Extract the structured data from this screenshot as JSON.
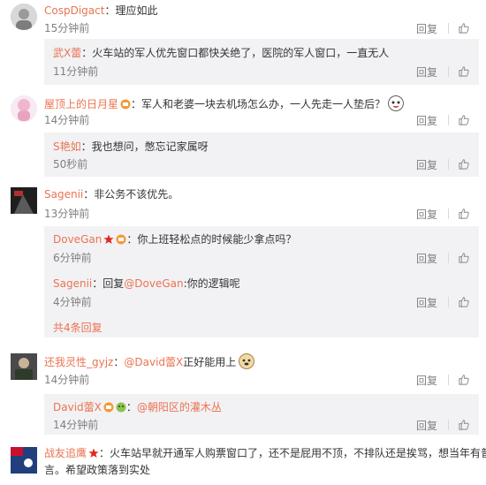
{
  "ui": {
    "reply_label": "回复",
    "at": "@"
  },
  "comments": [
    {
      "user": "CospDigact",
      "sep": "：",
      "text": "理应如此",
      "time": "15分钟前",
      "reply": {
        "user": "武X蕾",
        "sep": "：",
        "text": "火车站的军人优先窗口都快关绝了，医院的军人窗口，一直无人",
        "time": "11分钟前"
      }
    },
    {
      "user": "屋顶上的日月星",
      "sep": "：",
      "text": "军人和老婆一块去机场怎么办，一人先走一人垫后？",
      "time": "14分钟前",
      "reply": {
        "user": "S艳如",
        "sep": "：",
        "text": "我也想问，憋忘记家属呀",
        "time": "50秒前"
      }
    },
    {
      "user": "Sagenii",
      "sep": "：",
      "text": "非公务不该优先。",
      "time": "13分钟前",
      "replies": [
        {
          "user": "DoveGan",
          "sep": "：",
          "text": "你上班轻松点的时候能少拿点吗？",
          "time": "6分钟前"
        },
        {
          "user": "Sagenii",
          "sep": "：",
          "prefix": "回复",
          "target": "DoveGan",
          "text": ":你的逻辑呢",
          "time": "4分钟前"
        }
      ],
      "more": "共4条回复"
    },
    {
      "user": "还我灵性_gyjz",
      "sep": "：",
      "mention": "David蕾X",
      "text": "正好能用上",
      "time": "14分钟前",
      "reply": {
        "user": "David蕾X",
        "sep": "：",
        "mention": "朝阳区的灌木丛",
        "time": "14分钟前"
      }
    },
    {
      "user": "战友追鹰",
      "sep": "：",
      "text": "火车站早就开通军人购票窗口了，还不是屁用不顶，不排队还是挨骂，想当年有普推",
      "text2": "言。希望政策落到实处"
    }
  ],
  "colors": {
    "name": "#eb7350",
    "text": "#333333",
    "meta": "#808080",
    "reply_bg": "#f2f2f5"
  }
}
